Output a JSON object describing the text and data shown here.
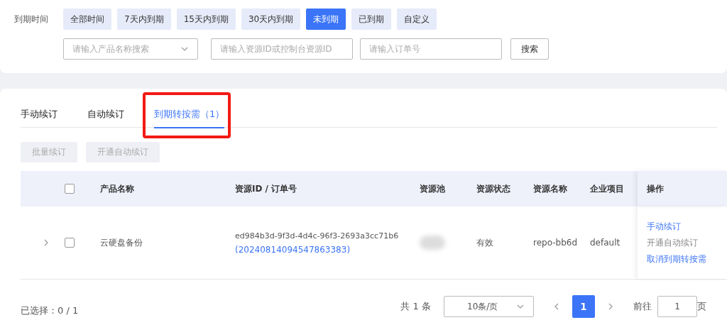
{
  "filter": {
    "label": "到期时间",
    "options": [
      {
        "label": "全部时间",
        "selected": false
      },
      {
        "label": "7天内到期",
        "selected": false
      },
      {
        "label": "15天内到期",
        "selected": false
      },
      {
        "label": "30天内到期",
        "selected": false
      },
      {
        "label": "未到期",
        "selected": true
      },
      {
        "label": "已到期",
        "selected": false
      },
      {
        "label": "自定义",
        "selected": false
      }
    ],
    "product_select": {
      "placeholder": "请输入产品名称搜索"
    },
    "resource_field": {
      "placeholder": "请输入资源ID或控制台资源ID"
    },
    "order_field": {
      "placeholder": "请输入订单号"
    },
    "search_button": "搜索"
  },
  "tabs": [
    {
      "label": "手动续订",
      "selected": false,
      "highlighted": false
    },
    {
      "label": "自动续订",
      "selected": false,
      "highlighted": false
    },
    {
      "label": "到期转按需（1）",
      "selected": true,
      "highlighted": true
    }
  ],
  "actions": [
    {
      "label": "批量续订",
      "disabled": true
    },
    {
      "label": "开通自动续订",
      "disabled": true
    }
  ],
  "table": {
    "header_checked": false,
    "columns": [
      "产品名称",
      "资源ID / 订单号",
      "资源池",
      "资源状态",
      "资源名称",
      "企业项目",
      "操作"
    ],
    "rows": [
      {
        "expanded": false,
        "checked": false,
        "product": "云硬盘备份",
        "resource_id": "ed984b3d-9f3d-4d4c-96f3-2693a3cc71b6",
        "order_id": "(20240814094547863383)",
        "pool": {
          "kind": "blurred"
        },
        "status": "有效",
        "name": "repo-bb6d",
        "project": "default",
        "operations": [
          {
            "label": "手动续订",
            "disabled": false
          },
          {
            "label": "开通自动续订",
            "disabled": true
          },
          {
            "label": "取消到期转按需",
            "disabled": false
          }
        ]
      }
    ]
  },
  "footer": {
    "selection": "已选择：0 / 1",
    "total": "共 1 条",
    "page_size": "10条/页",
    "pages": [
      {
        "label": "1",
        "selected": true
      }
    ],
    "goto_label": "前往",
    "goto_value": "1",
    "goto_suffix": "页"
  }
}
